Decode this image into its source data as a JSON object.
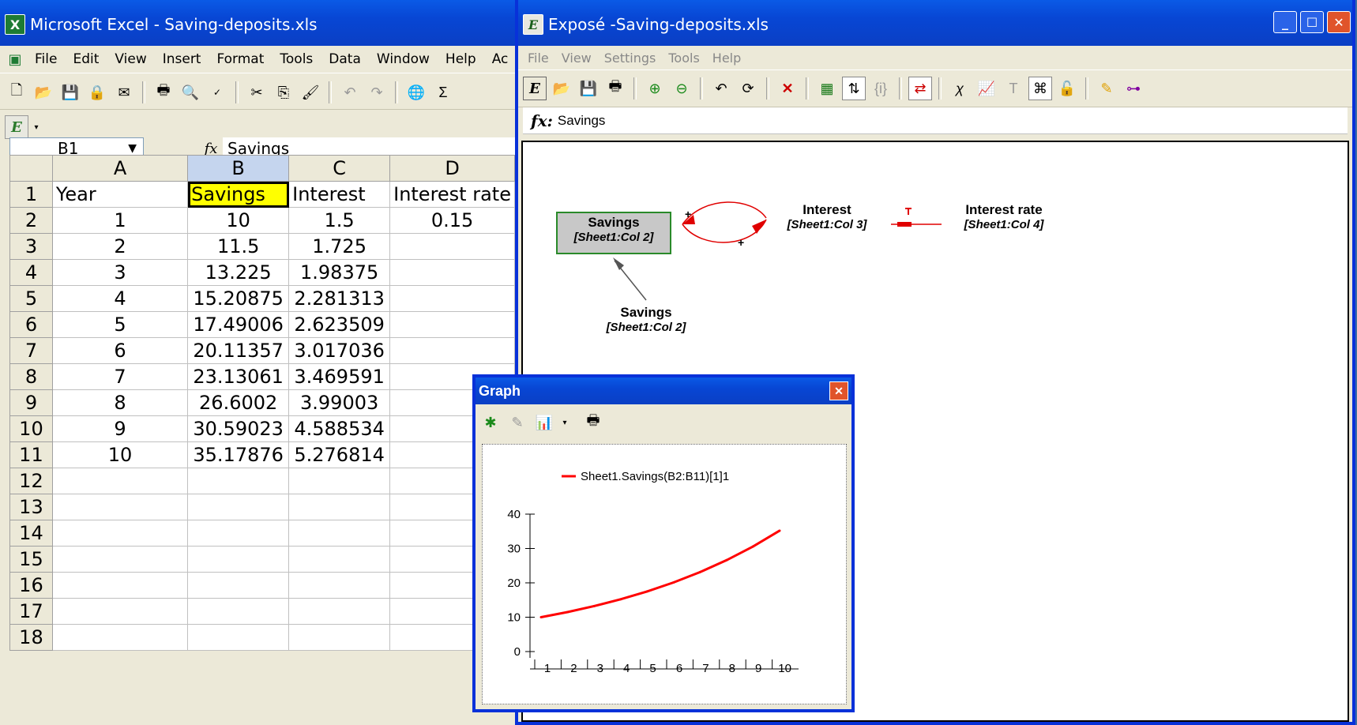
{
  "excel": {
    "title": "Microsoft Excel - Saving-deposits.xls",
    "menu": [
      "File",
      "Edit",
      "View",
      "Insert",
      "Format",
      "Tools",
      "Data",
      "Window",
      "Help",
      "Ac"
    ],
    "name_box": "B1",
    "formula": "Savings",
    "fx_label": "fx",
    "columns": [
      "A",
      "B",
      "C",
      "D"
    ],
    "rows": [
      [
        "1",
        "Year",
        "Savings",
        "Interest",
        "Interest rate"
      ],
      [
        "2",
        "1",
        "10",
        "1.5",
        "0.15"
      ],
      [
        "3",
        "2",
        "11.5",
        "1.725",
        ""
      ],
      [
        "4",
        "3",
        "13.225",
        "1.98375",
        ""
      ],
      [
        "5",
        "4",
        "15.20875",
        "2.281313",
        ""
      ],
      [
        "6",
        "5",
        "17.49006",
        "2.623509",
        ""
      ],
      [
        "7",
        "6",
        "20.11357",
        "3.017036",
        ""
      ],
      [
        "8",
        "7",
        "23.13061",
        "3.469591",
        ""
      ],
      [
        "9",
        "8",
        "26.6002",
        "3.99003",
        ""
      ],
      [
        "10",
        "9",
        "30.59023",
        "4.588534",
        ""
      ],
      [
        "11",
        "10",
        "35.17876",
        "5.276814",
        ""
      ],
      [
        "12",
        "",
        "",
        "",
        ""
      ],
      [
        "13",
        "",
        "",
        "",
        ""
      ],
      [
        "14",
        "",
        "",
        "",
        ""
      ],
      [
        "15",
        "",
        "",
        "",
        ""
      ],
      [
        "16",
        "",
        "",
        "",
        ""
      ],
      [
        "17",
        "",
        "",
        "",
        ""
      ],
      [
        "18",
        "",
        "",
        "",
        ""
      ]
    ]
  },
  "expose": {
    "title": "Exposé -Saving-deposits.xls",
    "menu": [
      "File",
      "View",
      "Settings",
      "Tools",
      "Help"
    ],
    "fx_label": "fx:",
    "formula": "Savings",
    "nodes": {
      "savings_box": {
        "name": "Savings",
        "ref": "[Sheet1:Col 2]"
      },
      "interest": {
        "name": "Interest",
        "ref": "[Sheet1:Col 3]"
      },
      "interest_rate": {
        "name": "Interest rate",
        "ref": "[Sheet1:Col 4]"
      },
      "savings_lower": {
        "name": "Savings",
        "ref": "[Sheet1:Col 2]"
      }
    }
  },
  "graph": {
    "title": "Graph",
    "legend": "Sheet1.Savings(B2:B11)[1]1",
    "series_color": "#ff0000"
  },
  "chart_data": {
    "type": "line",
    "x": [
      1,
      2,
      3,
      4,
      5,
      6,
      7,
      8,
      9,
      10
    ],
    "series": [
      {
        "name": "Sheet1.Savings(B2:B11)[1]1",
        "values": [
          10,
          11.5,
          13.225,
          15.20875,
          17.49006,
          20.11357,
          23.13061,
          26.6002,
          30.59023,
          35.17876
        ]
      }
    ],
    "ylim": [
      0,
      40
    ],
    "yticks": [
      0,
      10,
      20,
      30,
      40
    ],
    "xticks": [
      "1",
      "2",
      "3",
      "4",
      "5",
      "6",
      "7",
      "8",
      "9",
      "10"
    ]
  }
}
